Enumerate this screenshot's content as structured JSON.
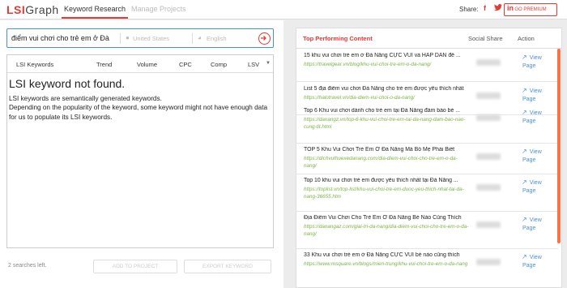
{
  "header": {
    "logo_lsi": "LSI",
    "logo_graph": "Graph",
    "tabs": [
      {
        "label": "Keyword Research",
        "active": true
      },
      {
        "label": "Manage Projects",
        "active": false
      }
    ],
    "share_label": "Share:",
    "social_icons": [
      "facebook-icon",
      "twitter-icon",
      "linkedin-icon"
    ],
    "premium_label": "GO PREMIUM",
    "accent_color": "#e53935"
  },
  "search": {
    "query": "điểm vui chơi cho trẻ em ở Đà",
    "location_placeholder": "United States",
    "language_placeholder": "English"
  },
  "keywords_table": {
    "columns": [
      "LSI Keywords",
      "Trend",
      "Volume",
      "CPC",
      "Comp",
      "LSV"
    ],
    "not_found_title": "LSI keyword not found.",
    "not_found_line1": "LSI keywords are semantically generated keywords.",
    "not_found_line2": "Depending on the popularity of the keyword, some keyword might not have enough data for us to populate its LSI keywords."
  },
  "footer": {
    "searches_left": "2 searches left.",
    "add_to_project": "ADD TO PROJECT",
    "export_keyword": "EXPORT KEYWORD"
  },
  "top_content": {
    "title": "Top Performing Content",
    "social_share_header": "Social Share",
    "action_header": "Action",
    "view_label": "View",
    "page_label": "Page",
    "results": [
      {
        "title": "15 khu vui chơi trẻ em ở Đà Nẵng CỰC VUI và HẤP DẪN để ...",
        "url": "https://travelgear.vn/blog/khu-vui-choi-tre-em-o-da-nang/"
      },
      {
        "title": "List 5 địa điểm vui chơi Đà Nẵng cho trẻ em được yêu thích nhất",
        "url": "https://halotravel.vn/dia-diem-vui-choi-o-da-nang/"
      },
      {
        "title": "Top 6 Khu vui chơi dành cho trẻ em tại Đà Nẵng đảm bảo bé ...",
        "url": "https://danangz.vn/top-6-khu-vui-choi-tre-em-tai-da-nang-dam-bao-nao-cung-tit.html"
      },
      {
        "title": "TOP 5 Khu Vui Chơi Trẻ Em Ở Đà Nẵng Mà Bố Mẹ Phải Biết",
        "url": "https://dichvuthuexedanang.com/dia-diem-vui-choi-cho-tre-em-o-da-nang/"
      },
      {
        "title": "Top 10 khu vui chơi trẻ em được yêu thích nhất tại Đà Nẵng ...",
        "url": "https://toplist.vn/top-list/khu-vui-choi-tre-em-duoc-yeu-thich-nhat-tai-da-nang-36655.htm"
      },
      {
        "title": "Địa Điểm Vui Chơi Cho Trẻ Em Ở Đà Nẵng Bé Nào Cũng Thích",
        "url": "https://danangaz.com/giai-tri-da-nang/dia-diem-vui-choi-cho-tre-em-o-da-nang/"
      },
      {
        "title": "33 Khu vui chơi trẻ em ở Đà Nẵng CỰC VUI bé nào cũng thích",
        "url": "https://www.msquare.vn/blogs/mien-trung/khu-vui-choi-tre-em-o-da-nang"
      }
    ]
  }
}
